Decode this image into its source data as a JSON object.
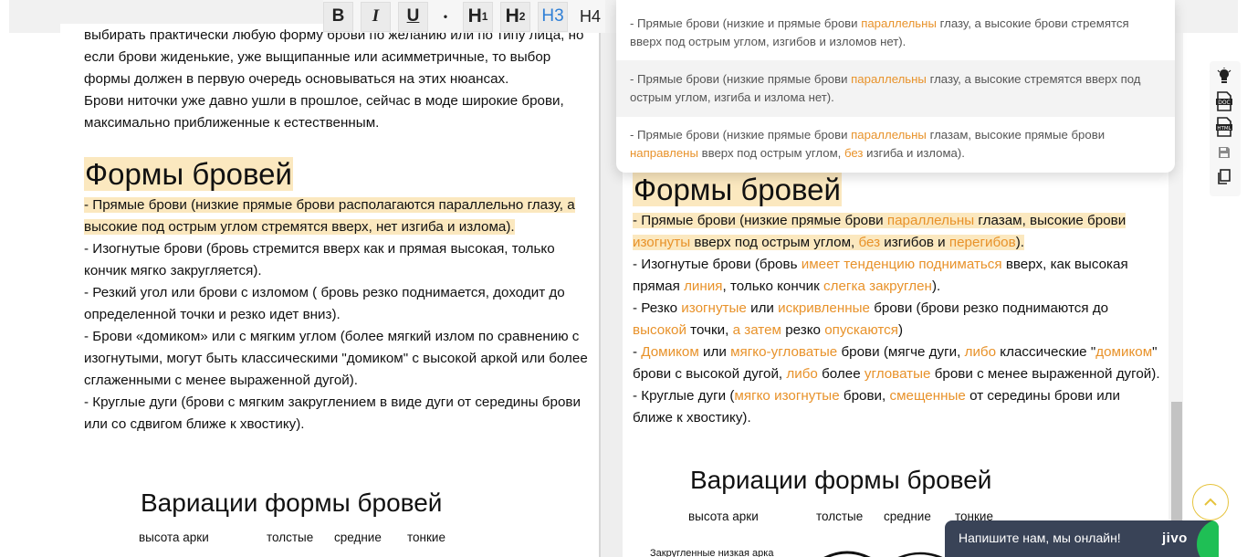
{
  "toolbar": {
    "bold": "B",
    "italic": "I",
    "underline": "U",
    "dot": "•",
    "h1": "H",
    "h1_sub": "1",
    "h2": "H",
    "h2_sub": "2",
    "h3": "H3",
    "h4": "H4"
  },
  "left": {
    "intro_1": "выбирать практически любую форму брови по желанию или по типу лица, но если брови жиденькие, уже выщипанные или асимметричные, то выбор формы должен в первую очередь основываться на этих нюансах.",
    "intro_2": "Брови ниточки уже давно ушли в прошлое, сейчас в моде широкие брови, максимально приближенные к естественным.",
    "heading": "Формы бровей",
    "item_1": "- Прямые брови (низкие прямые брови располагаются параллельно глазу, а высокие под острым углом стремятся вверх, нет изгиба и излома).",
    "item_2": "- Изогнутые брови (бровь стремится вверх как и прямая высокая, только кончик мягко закругляется).",
    "item_3": "- Резкий угол или брови с изломом ( бровь резко поднимается, доходит до определенной точки и резко идет вниз).",
    "item_4": "- Брови «домиком» или с мягким углом (более мягкий излом по сравнению с изогнутыми, могут быть классическими \"домиком\" с высокой аркой или более сглаженными с менее выраженной дугой).",
    "item_5": "- Круглые дуги (брови с мягким закруглением в виде дуги от середины брови или со сдвигом ближе к хвостику).",
    "figure": {
      "title": "Вариации формы бровей",
      "col_arch": "высота арки",
      "col_thick": "толстые",
      "col_medium": "средние",
      "col_thin": "тонкие"
    }
  },
  "right": {
    "heading": "Формы бровей",
    "p1": [
      "- Прямые брови (низкие прямые брови ",
      "параллельны",
      " глазам, высокие брови ",
      "изогнуты",
      " вверх под острым углом, ",
      "без",
      " изгибов и ",
      "перегибов",
      ")."
    ],
    "p2": [
      "- Изогнутые брови (бровь ",
      "имеет тенденцию подниматься",
      " вверх, как высокая прямая ",
      "линия",
      ", только кончик ",
      "слегка закруглен",
      ")."
    ],
    "p3": [
      "- Резко ",
      "изогнутые",
      " или ",
      "искривленные",
      " брови (брови резко поднимаются до ",
      "высокой",
      " точки, ",
      "а затем",
      " резко ",
      "опускаются",
      ")"
    ],
    "p4": [
      "- ",
      "Домиком",
      " или ",
      "мягко-угловатые",
      " брови (мягче дуги, ",
      "либо",
      " классические \"",
      "домиком",
      "\" брови с высокой дугой, ",
      "либо",
      " более ",
      "угловатые",
      " брови с менее выраженной дугой)."
    ],
    "p5": [
      "- Круглые дуги (",
      "мягко изогнутые",
      " брови, ",
      "смещенные",
      " от середины брови или ближе к хвостику)."
    ],
    "figure": {
      "title": "Вариации формы бровей",
      "col_arch": "высота арки",
      "col_thick": "толстые",
      "col_medium": "средние",
      "col_thin": "тонкие",
      "row_1": "Закругленные низкая арка"
    }
  },
  "suggestions": [
    [
      "- Прямые брови (низкие и прямые брови ",
      "параллельны",
      " глазу, а высокие брови стремятся вверх под острым углом, изгибов и изломов нет)."
    ],
    [
      "- Прямые брови (низкие прямые брови ",
      "параллельны",
      " глазу, а высокие стремятся вверх под острым углом, изгиба и излома нет)."
    ],
    [
      "- Прямые брови (низкие прямые брови ",
      "параллельны",
      " глазам, высокие прямые брови ",
      "направлены",
      " вверх под острым углом, ",
      "без",
      " изгиба и излома)."
    ]
  ],
  "chat": {
    "text": "Напишите нам, мы онлайн!",
    "logo": "jivo"
  },
  "colors": {
    "accent_orange": "#e8922a",
    "highlight": "#fbe8bf",
    "h3_active": "#2f7fd6",
    "chat_bg": "#394357",
    "chat_green": "#1fbf55",
    "to_top_ring": "#e6c33c"
  },
  "icons": {
    "rail": [
      "bulb-icon",
      "doc-icon",
      "html-icon",
      "save-icon",
      "copy-icon"
    ],
    "to_top": "chevron-up-icon"
  }
}
